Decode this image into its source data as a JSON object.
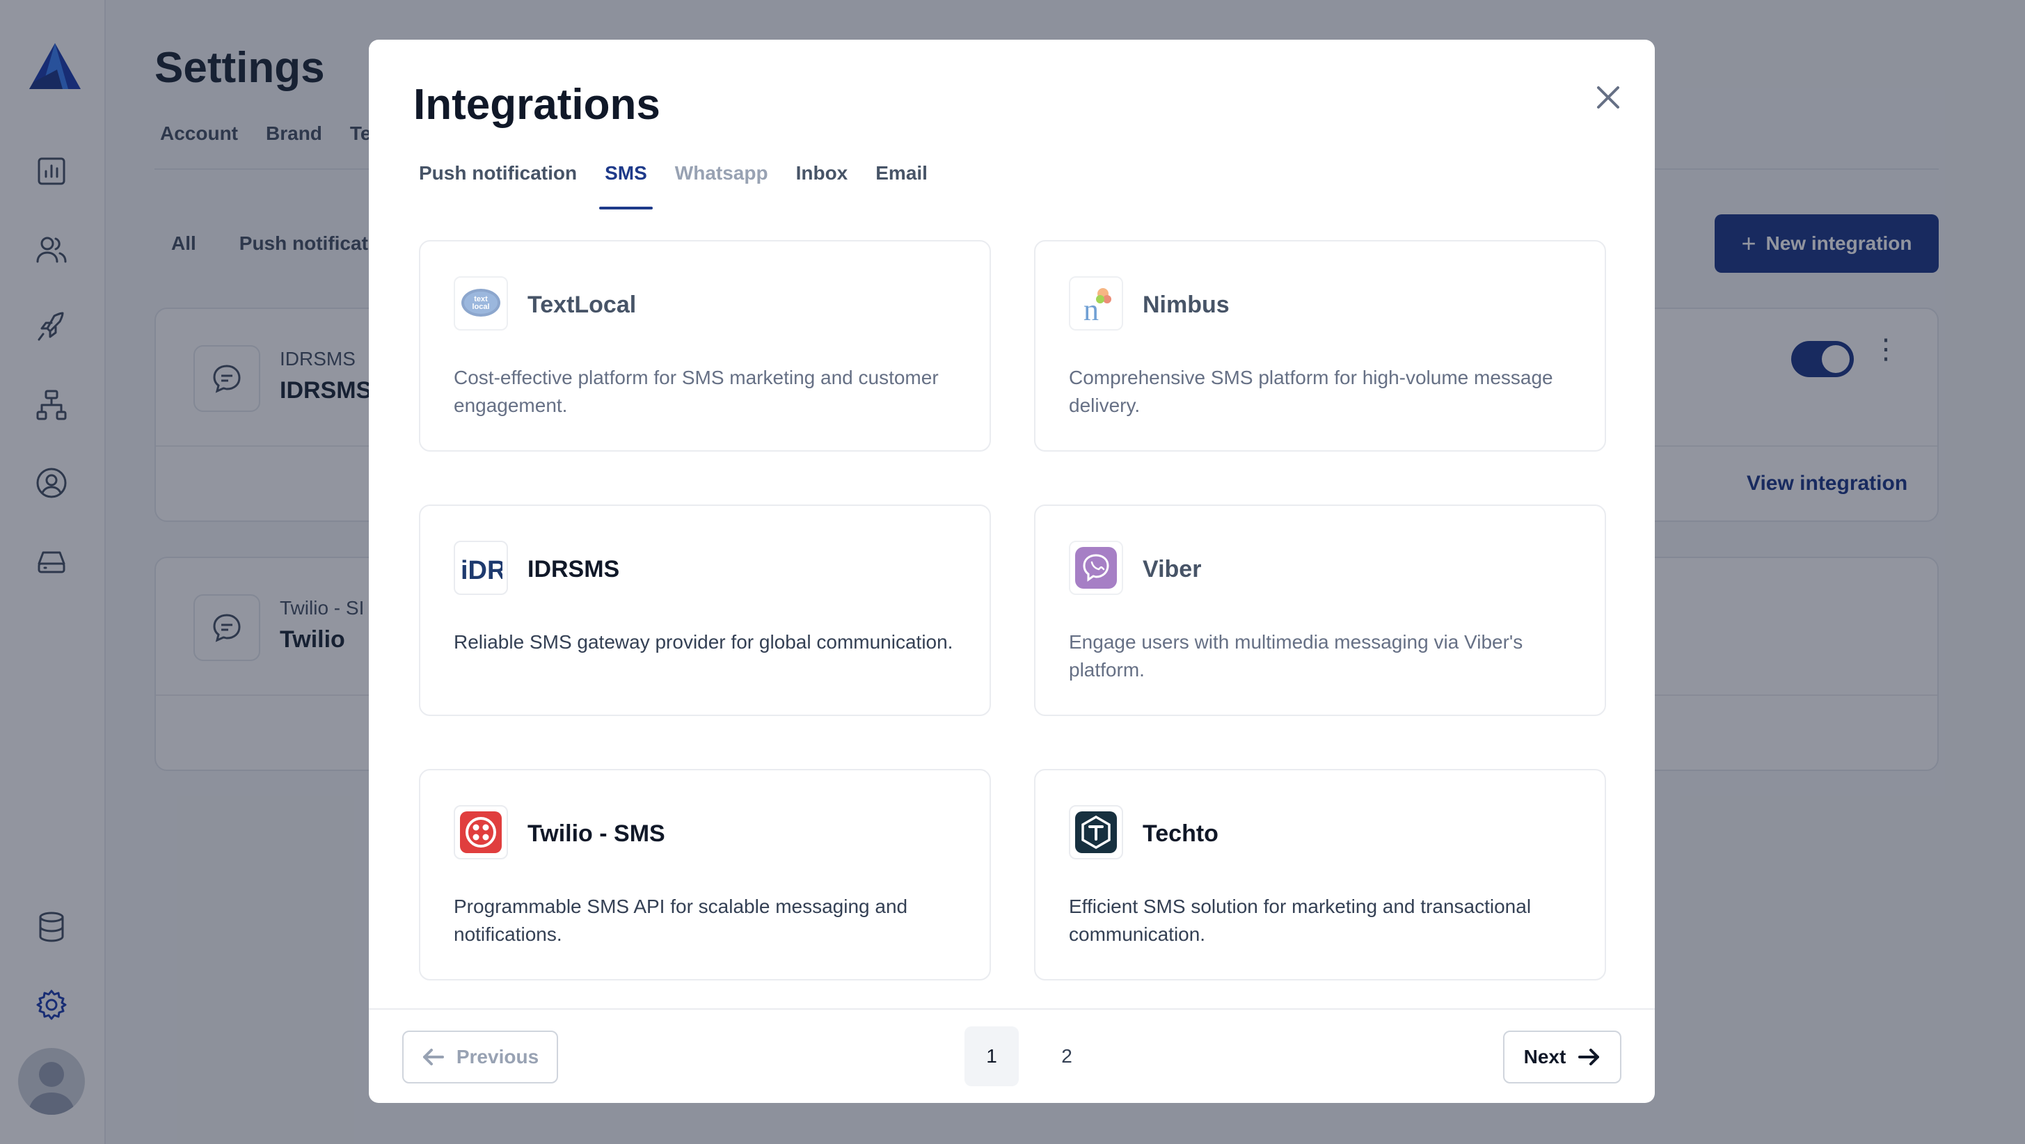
{
  "app": {
    "page_title": "Settings",
    "top_tabs": [
      "Account",
      "Brand",
      "Te"
    ],
    "filter_tabs": [
      "All",
      "Push notificat"
    ],
    "new_integration_label": "New integration",
    "integrations": [
      {
        "provider_small": "IDRSMS",
        "provider_big": "IDRSMS",
        "view_label": "View integration"
      },
      {
        "provider_small": "Twilio - SI",
        "provider_big": "Twilio"
      }
    ]
  },
  "modal": {
    "title": "Integrations",
    "tabs": [
      {
        "label": "Push notification",
        "state": "normal"
      },
      {
        "label": "SMS",
        "state": "active"
      },
      {
        "label": "Whatsapp",
        "state": "disabled"
      },
      {
        "label": "Inbox",
        "state": "normal"
      },
      {
        "label": "Email",
        "state": "normal"
      }
    ],
    "cards": [
      {
        "name": "TextLocal",
        "desc": "Cost-effective platform for SMS marketing and customer engagement.",
        "logo": "textlocal-logo",
        "dim": true
      },
      {
        "name": "Nimbus",
        "desc": "Comprehensive SMS platform for high-volume message delivery.",
        "logo": "nimbus-logo",
        "dim": true
      },
      {
        "name": "IDRSMS",
        "desc": "Reliable SMS gateway provider for global communication.",
        "logo": "idr-logo",
        "dim": false
      },
      {
        "name": "Viber",
        "desc": "Engage users with multimedia messaging via Viber's platform.",
        "logo": "viber-logo",
        "dim": true
      },
      {
        "name": "Twilio - SMS",
        "desc": "Programmable SMS API for scalable messaging and notifications.",
        "logo": "twilio-logo",
        "dim": false
      },
      {
        "name": "Techto",
        "desc": "Efficient SMS solution for marketing and transactional communication.",
        "logo": "techto-logo",
        "dim": false
      }
    ],
    "pagination": {
      "previous_label": "Previous",
      "next_label": "Next",
      "pages": [
        "1",
        "2"
      ],
      "current_page": "1"
    }
  }
}
